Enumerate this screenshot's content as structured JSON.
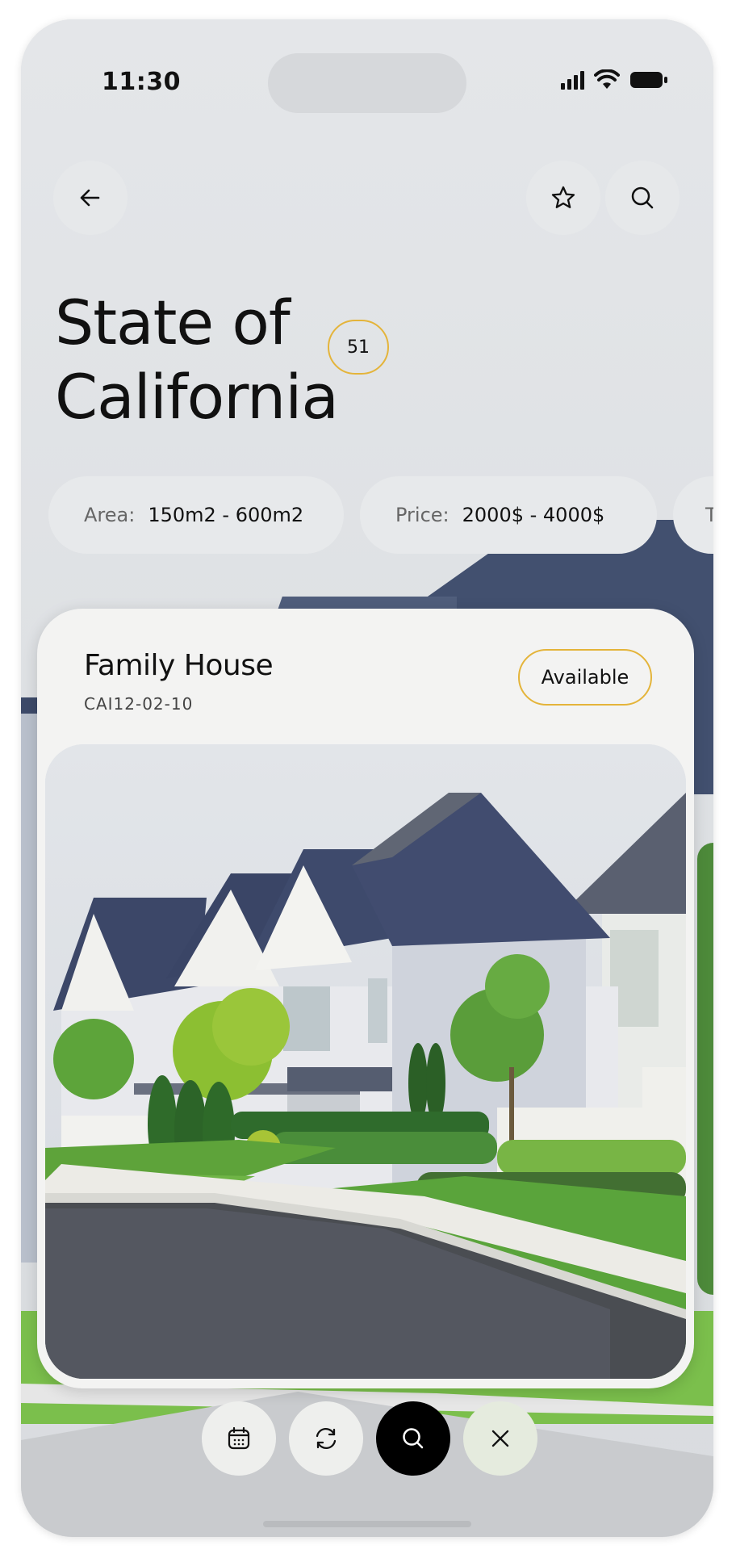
{
  "status_bar": {
    "time": "11:30"
  },
  "header": {
    "back_icon": "arrow-left-icon",
    "favorite_icon": "star-icon",
    "search_icon": "search-icon"
  },
  "page": {
    "title_line1": "State of",
    "title_line2": "California",
    "count": "51"
  },
  "filters": [
    {
      "label": "Area:",
      "value": "150m2 - 600m2"
    },
    {
      "label": "Price:",
      "value": "2000$ - 4000$"
    },
    {
      "label": "T",
      "value": ""
    }
  ],
  "listing": {
    "name": "Family House",
    "code": "CAI12-02-10",
    "status": "Available",
    "image": "suburban-houses-photo"
  },
  "actions": [
    {
      "icon": "calendar-icon"
    },
    {
      "icon": "refresh-icon"
    },
    {
      "icon": "search-icon"
    },
    {
      "icon": "close-icon"
    }
  ],
  "colors": {
    "accent": "#e4b43a",
    "background": "#dfe1e4",
    "card": "#f3f3f2",
    "dark_button": "#000000"
  }
}
